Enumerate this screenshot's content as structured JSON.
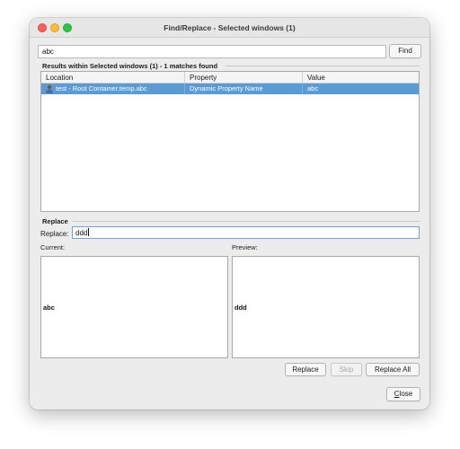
{
  "window": {
    "title": "Find/Replace - Selected windows (1)"
  },
  "search": {
    "value": "abc",
    "find_label": "Find"
  },
  "results": {
    "label": "Results within Selected windows (1) - 1 matches found",
    "columns": [
      "Location",
      "Property",
      "Value"
    ],
    "rows": [
      {
        "location": "test - Root Container.temp.abc",
        "property": "Dynamic Property Name",
        "value": "abc",
        "icon": "user-component-icon"
      }
    ]
  },
  "replace": {
    "section_label": "Replace",
    "field_label": "Replace:",
    "value": "ddd",
    "current_label": "Current:",
    "preview_label": "Preview:",
    "current_text": "abc",
    "preview_text": "ddd",
    "replace_button": "Replace",
    "skip_button": "Skip",
    "replace_all_button": "Replace All"
  },
  "footer": {
    "close_first": "C",
    "close_rest": "lose"
  },
  "colors": {
    "selection": "#5b9bd5",
    "focus_ring": "#6ea2d9"
  }
}
